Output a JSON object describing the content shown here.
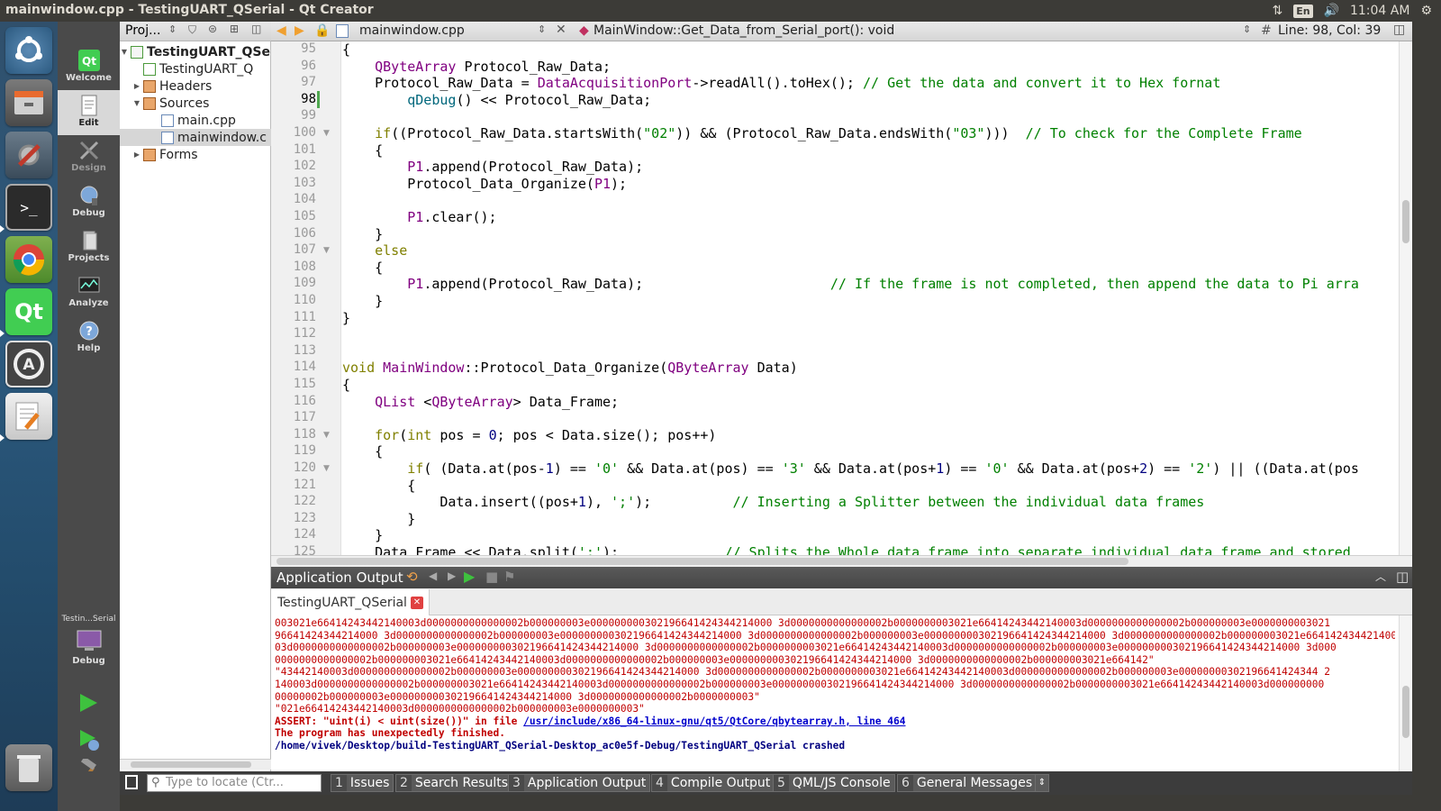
{
  "window": {
    "title": "mainwindow.cpp - TestingUART_QSerial - Qt Creator"
  },
  "tray": {
    "keyboard": "En",
    "time": "11:04 AM"
  },
  "modes": [
    {
      "label": "Welcome"
    },
    {
      "label": "Edit"
    },
    {
      "label": "Design"
    },
    {
      "label": "Debug"
    },
    {
      "label": "Projects"
    },
    {
      "label": "Analyze"
    },
    {
      "label": "Help"
    }
  ],
  "kit": {
    "label": "Testin...Serial",
    "mode": "Debug"
  },
  "projects": {
    "header": "Proj...",
    "tree": [
      {
        "label": "TestingUART_QSe",
        "bold": true
      },
      {
        "label": "TestingUART_Q"
      },
      {
        "label": "Headers"
      },
      {
        "label": "Sources"
      },
      {
        "label": "main.cpp"
      },
      {
        "label": "mainwindow.c"
      },
      {
        "label": "Forms"
      }
    ]
  },
  "editor": {
    "file": "mainwindow.cpp",
    "symbol": "MainWindow::Get_Data_from_Serial_port(): void",
    "position": "Line: 98, Col: 39",
    "line_start": 95,
    "current_line": 98,
    "line_numbers": [
      "95",
      "96",
      "97",
      "98",
      "99",
      "100",
      "101",
      "102",
      "103",
      "104",
      "105",
      "106",
      "107",
      "108",
      "109",
      "110",
      "111",
      "112",
      "113",
      "114",
      "115",
      "116",
      "117",
      "118",
      "119",
      "120",
      "121",
      "122",
      "123",
      "124",
      "125"
    ]
  },
  "output": {
    "title": "Application Output",
    "tab": "TestingUART_QSerial",
    "data_lines": [
      "003021e66414243442140003d0000000000000002b000000003e000000000302196641424344214000 3d0000000000000002b0000000003021e66414243442140003d0000000000000002b000000003e0000000003021",
      "96641424344214000 3d0000000000000002b000000003e000000000302196641424344214000 3d0000000000000002b000000003e000000000302196641424344214000 3d0000000000000002b000000003021e664142434421400",
      "03d0000000000000002b000000003e000000000302196641424344214000 3d0000000000000002b0000000003021e66414243442140003d0000000000000002b000000003e000000000302196641424344214000 3d000",
      "0000000000000002b000000003021e66414243442140003d0000000000000002b000000003e000000000302196641424344214000 3d0000000000000002b000000003021e664142\"",
      "\"43442140003d0000000000000002b000000003e000000000302196641424344214000 3d0000000000000002b0000000003021e66414243442140003d0000000000000002b000000003e00000000302196641424344 2",
      "140003d0000000000000002b000000003021e66414243442140003d0000000000000002b000000003e000000000302196641424344214000 3d0000000000000002b0000000003021e66414243442140003d000000000",
      "00000002b000000003e000000000302196641424344214000 3d0000000000000002b0000000003\"",
      "\"021e66414243442140003d0000000000000002b000000003e0000000003\""
    ],
    "assert_prefix": "ASSERT: \"uint(i) < uint(size())\" in file ",
    "assert_link": "/usr/include/x86_64-linux-gnu/qt5/QtCore/qbytearray.h, line 464",
    "finished": "The program has unexpectedly finished.",
    "crashed": "/home/vivek/Desktop/build-TestingUART_QSerial-Desktop_ac0e5f-Debug/TestingUART_QSerial crashed"
  },
  "statusbar": {
    "locator_placeholder": "Type to locate (Ctr...",
    "tabs": [
      {
        "num": "1",
        "label": "Issues"
      },
      {
        "num": "2",
        "label": "Search Results"
      },
      {
        "num": "3",
        "label": "Application Output"
      },
      {
        "num": "4",
        "label": "Compile Output"
      },
      {
        "num": "5",
        "label": "QML/JS Console"
      },
      {
        "num": "6",
        "label": "General Messages"
      }
    ]
  }
}
